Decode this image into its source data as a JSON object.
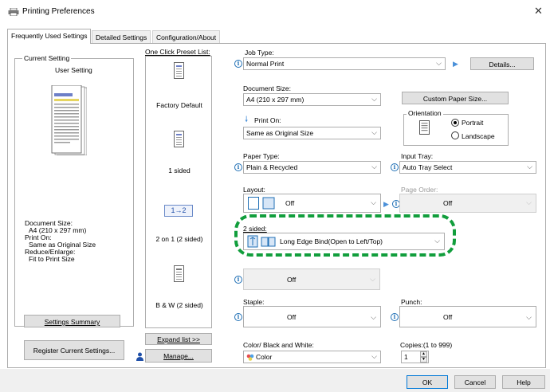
{
  "window": {
    "title": "Printing Preferences",
    "close_icon": "close-icon"
  },
  "tabs": [
    {
      "label": "Frequently Used Settings",
      "active": true
    },
    {
      "label": "Detailed Settings",
      "active": false
    },
    {
      "label": "Configuration/About",
      "active": false
    }
  ],
  "current_setting": {
    "group_label": "Current Setting",
    "name": "User Setting",
    "summary_lines": [
      "Document Size:",
      "  A4 (210 x 297 mm)",
      "Print On:",
      "  Same as Original Size",
      "Reduce/Enlarge:",
      "  Fit to Print Size"
    ],
    "settings_summary_button": "Settings Summary",
    "register_button": "Register Current Settings..."
  },
  "presets": {
    "label": "One Click Preset List:",
    "items": [
      {
        "label": "Factory Default"
      },
      {
        "label": "1 sided"
      },
      {
        "label": "2 on 1 (2 sided)",
        "badge": "1→2"
      },
      {
        "label": "B & W (2 sided)"
      }
    ],
    "expand_button": "Expand list >>",
    "manage_button": "Manage..."
  },
  "job_type": {
    "label": "Job Type:",
    "value": "Normal Print",
    "details_button": "Details..."
  },
  "document_size": {
    "label": "Document Size:",
    "value": "A4 (210 x 297 mm)",
    "custom_button": "Custom Paper Size..."
  },
  "print_on": {
    "label": "Print On:",
    "value": "Same as Original Size"
  },
  "orientation": {
    "label": "Orientation",
    "options": [
      "Portrait",
      "Landscape"
    ],
    "selected": "Portrait"
  },
  "paper_type": {
    "label": "Paper Type:",
    "value": "Plain & Recycled"
  },
  "input_tray": {
    "label": "Input Tray:",
    "value": "Auto Tray Select"
  },
  "layout": {
    "label": "Layout:",
    "value": "Off"
  },
  "page_order": {
    "label": "Page Order:",
    "value": "Off"
  },
  "two_sided": {
    "label": "2 sided:",
    "value": "Long Edge Bind(Open to Left/Top)"
  },
  "booklet": {
    "value": "Off"
  },
  "staple": {
    "label": "Staple:",
    "value": "Off"
  },
  "punch": {
    "label": "Punch:",
    "value": "Off"
  },
  "color": {
    "label": "Color/ Black and White:",
    "value": "Color"
  },
  "copies": {
    "label": "Copies:(1 to 999)",
    "value": "1"
  },
  "footer": {
    "ok": "OK",
    "cancel": "Cancel",
    "help": "Help"
  },
  "colors": {
    "accent": "#0078d7",
    "highlight": "#119e3c",
    "info": "#1f6fb5"
  }
}
